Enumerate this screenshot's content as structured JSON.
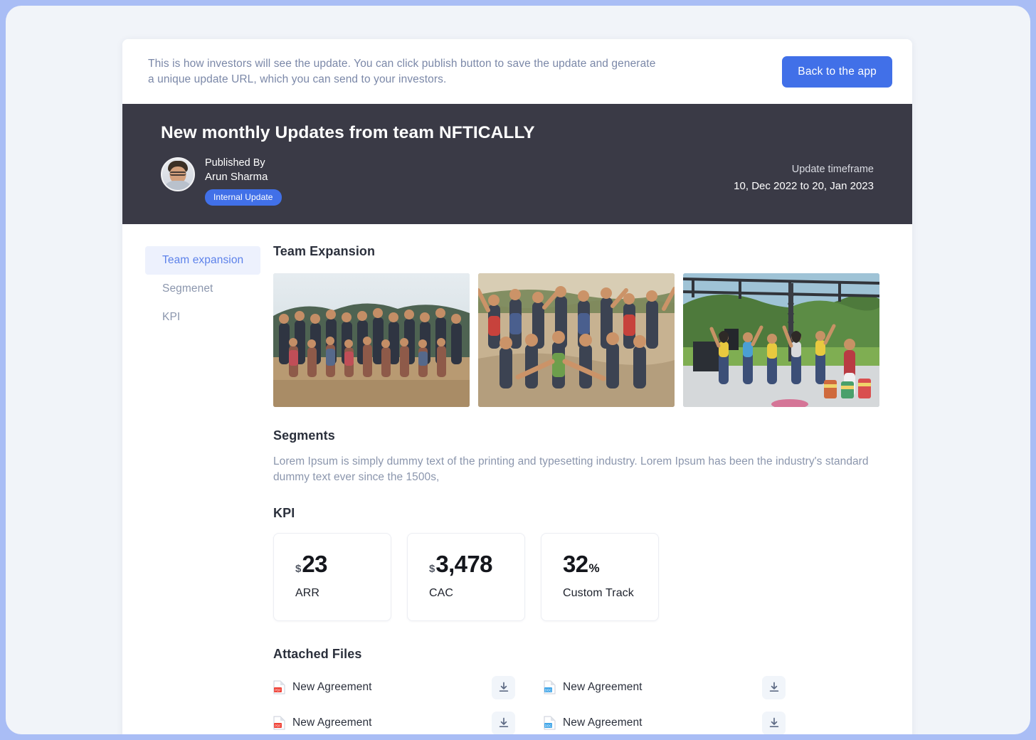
{
  "notice": {
    "text": "This is how investors will see the update. You can click publish button to save the update and generate a unique update URL, which you can send to your investors.",
    "back_button": "Back to the app"
  },
  "header": {
    "title": "New monthly Updates  from team NFTICALLY",
    "published_by_label": "Published By",
    "author": "Arun Sharma",
    "badge": "Internal Update",
    "timeframe_label": "Update timeframe",
    "timeframe_value": "10, Dec 2022 to 20, Jan 2023"
  },
  "sidebar": {
    "items": [
      {
        "label": "Team expansion",
        "active": true
      },
      {
        "label": "Segmenet",
        "active": false
      },
      {
        "label": "KPI",
        "active": false
      }
    ]
  },
  "team_expansion": {
    "title": "Team Expansion",
    "photos": [
      {
        "caption": "Large group team photo outdoors"
      },
      {
        "caption": "Team members cheering with arms raised"
      },
      {
        "caption": "Team dance event under outdoor canopy"
      }
    ]
  },
  "segments": {
    "title": "Segments",
    "body": "Lorem Ipsum is simply dummy text of the printing and typesetting industry. Lorem Ipsum has been the industry's standard dummy text ever since the 1500s,"
  },
  "kpi": {
    "title": "KPI",
    "cards": [
      {
        "prefix": "$",
        "value": "23",
        "suffix": "",
        "label": "ARR"
      },
      {
        "prefix": "$",
        "value": "3,478",
        "suffix": "",
        "label": "CAC"
      },
      {
        "prefix": "",
        "value": "32",
        "suffix": "%",
        "label": "Custom Track"
      }
    ]
  },
  "attached_files": {
    "title": "Attached Files",
    "files": [
      {
        "name": "New Agreement",
        "type": "pdf"
      },
      {
        "name": "New Agreement",
        "type": "doc"
      },
      {
        "name": "New Agreement",
        "type": "pdf"
      },
      {
        "name": "New Agreement",
        "type": "doc"
      }
    ],
    "download_icon": "download-icon"
  },
  "colors": {
    "accent": "#4170e8",
    "header_bg": "#3a3a46",
    "page_bg": "#f1f4f9",
    "frame": "#a9bdf5",
    "muted_text": "#8b96ad",
    "pdf": "#ef4136",
    "doc": "#41a6e8"
  }
}
